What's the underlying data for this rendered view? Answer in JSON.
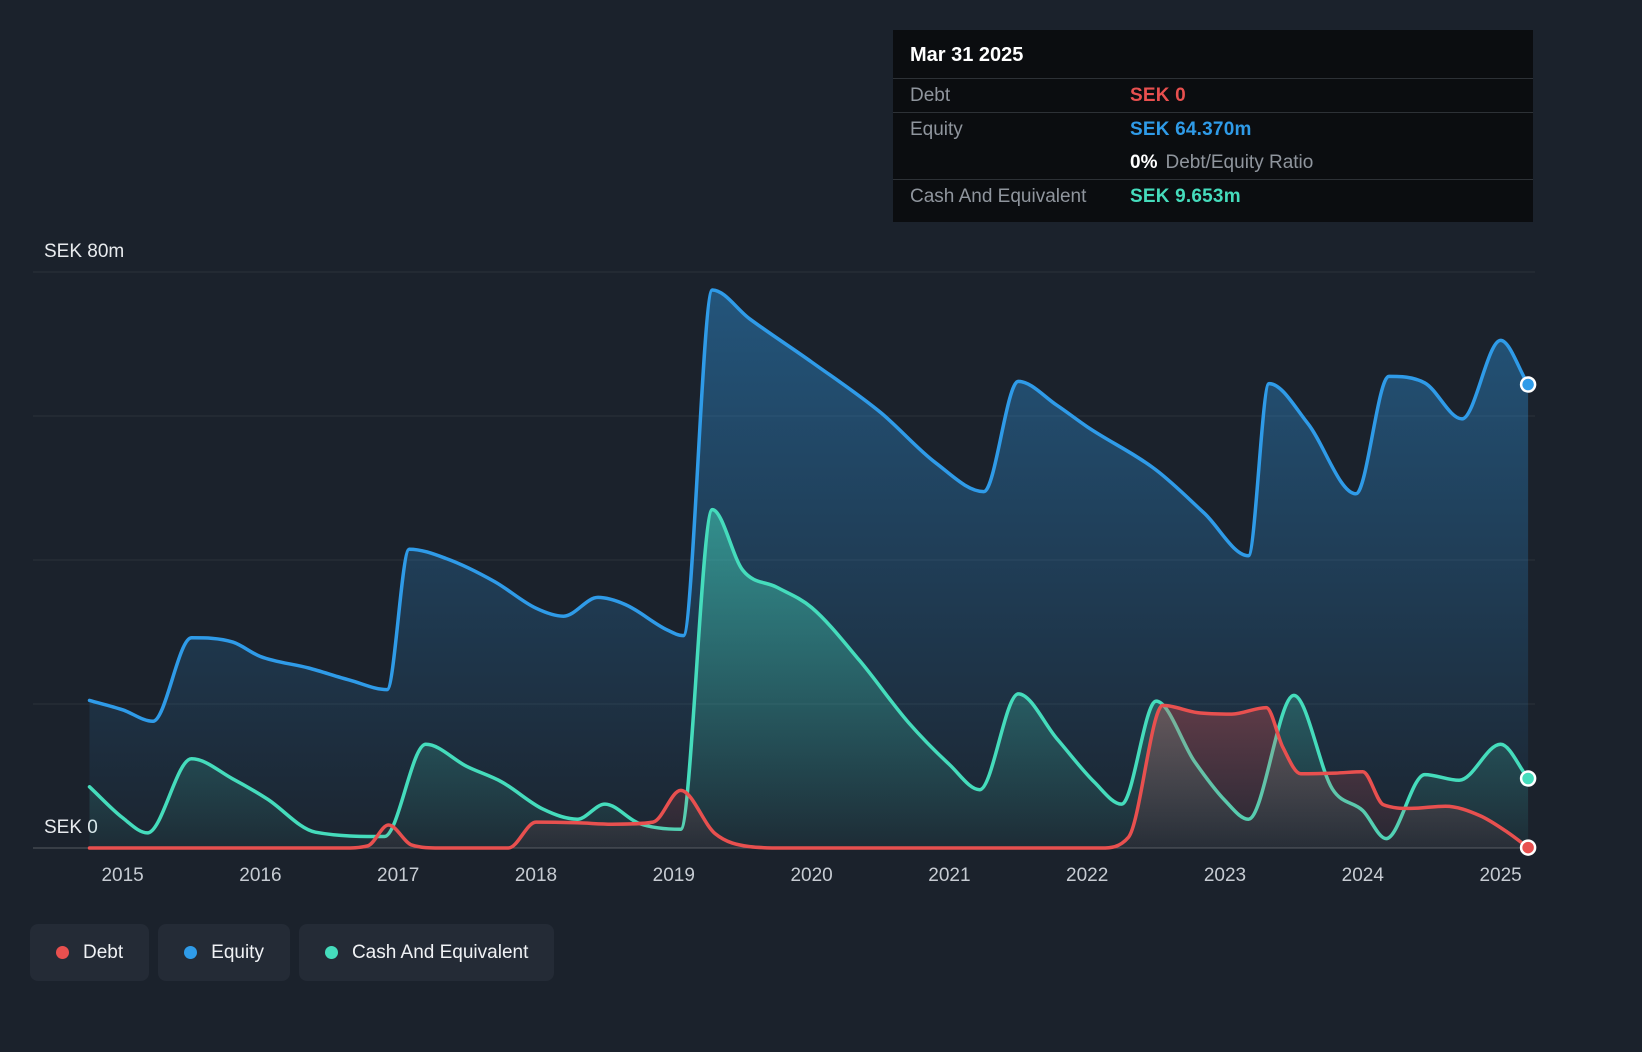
{
  "page": {
    "background": "#1b222c"
  },
  "tooltip": {
    "date": "Mar 31 2025",
    "debt": {
      "label": "Debt",
      "value": "SEK 0",
      "color": "#e8504f"
    },
    "equity": {
      "label": "Equity",
      "value": "SEK 64.370m",
      "color": "#2f9be8"
    },
    "ratio": {
      "value": "0%",
      "label": "Debt/Equity Ratio"
    },
    "cash": {
      "label": "Cash And Equivalent",
      "value": "SEK 9.653m",
      "color": "#45dcbc"
    }
  },
  "legend": {
    "items": [
      {
        "key": "debt",
        "label": "Debt",
        "color": "#e8504f"
      },
      {
        "key": "equity",
        "label": "Equity",
        "color": "#2f9be8"
      },
      {
        "key": "cash",
        "label": "Cash And Equivalent",
        "color": "#45dcbc"
      }
    ]
  },
  "chart_data": {
    "type": "area",
    "title": "",
    "xlim": [
      2014.35,
      2025.25
    ],
    "ylim": [
      0,
      80
    ],
    "gridlines": [
      0,
      20,
      40,
      60,
      80
    ],
    "x_ticks": [
      2015,
      2016,
      2017,
      2018,
      2019,
      2020,
      2021,
      2022,
      2023,
      2024,
      2025
    ],
    "y_ticks": [
      {
        "value": 80,
        "label": "SEK 80m"
      },
      {
        "value": 0,
        "label": "SEK 0"
      }
    ],
    "draw_order": [
      "equity",
      "cash",
      "debt"
    ],
    "series": [
      {
        "key": "debt",
        "name": "Debt",
        "color": "#e8504f",
        "fill_top": 0.32,
        "fill_bottom": 0.05,
        "points": [
          [
            2014.76,
            0
          ],
          [
            2015.5,
            0
          ],
          [
            2016.3,
            0
          ],
          [
            2016.6,
            0
          ],
          [
            2016.78,
            0.3
          ],
          [
            2016.93,
            3.2
          ],
          [
            2017.1,
            0.4
          ],
          [
            2017.3,
            0
          ],
          [
            2017.8,
            0
          ],
          [
            2018.0,
            3.6
          ],
          [
            2018.3,
            3.5
          ],
          [
            2018.55,
            3.3
          ],
          [
            2018.85,
            3.6
          ],
          [
            2019.05,
            8.0
          ],
          [
            2019.3,
            2.0
          ],
          [
            2019.55,
            0.2
          ],
          [
            2019.8,
            0
          ],
          [
            2020.5,
            0
          ],
          [
            2021.3,
            0
          ],
          [
            2022.1,
            0
          ],
          [
            2022.3,
            1.5
          ],
          [
            2022.55,
            19.8
          ],
          [
            2022.8,
            18.8
          ],
          [
            2023.05,
            18.6
          ],
          [
            2023.3,
            19.5
          ],
          [
            2023.42,
            14.0
          ],
          [
            2023.55,
            10.3
          ],
          [
            2023.8,
            10.4
          ],
          [
            2024.0,
            10.6
          ],
          [
            2024.15,
            6.0
          ],
          [
            2024.35,
            5.5
          ],
          [
            2024.6,
            5.8
          ],
          [
            2024.85,
            4.5
          ],
          [
            2025.05,
            2.2
          ],
          [
            2025.2,
            0.05
          ]
        ]
      },
      {
        "key": "equity",
        "name": "Equity",
        "color": "#2f9be8",
        "fill_top": 0.42,
        "fill_bottom": 0.02,
        "points": [
          [
            2014.76,
            20.5
          ],
          [
            2015.0,
            19.2
          ],
          [
            2015.22,
            17.6
          ],
          [
            2015.5,
            29.2
          ],
          [
            2015.8,
            28.6
          ],
          [
            2016.0,
            26.6
          ],
          [
            2016.35,
            25.0
          ],
          [
            2016.65,
            23.3
          ],
          [
            2016.92,
            22.0
          ],
          [
            2017.08,
            41.5
          ],
          [
            2017.35,
            40.2
          ],
          [
            2017.7,
            37.0
          ],
          [
            2018.0,
            33.3
          ],
          [
            2018.2,
            32.2
          ],
          [
            2018.45,
            34.8
          ],
          [
            2018.65,
            33.8
          ],
          [
            2018.95,
            30.3
          ],
          [
            2019.07,
            29.5
          ],
          [
            2019.28,
            77.5
          ],
          [
            2019.55,
            73.5
          ],
          [
            2020.0,
            67.5
          ],
          [
            2020.5,
            60.5
          ],
          [
            2020.9,
            53.5
          ],
          [
            2021.25,
            49.5
          ],
          [
            2021.5,
            64.8
          ],
          [
            2021.78,
            61.5
          ],
          [
            2022.0,
            58.5
          ],
          [
            2022.5,
            52.5
          ],
          [
            2022.85,
            46.5
          ],
          [
            2023.17,
            40.6
          ],
          [
            2023.32,
            64.5
          ],
          [
            2023.6,
            59.0
          ],
          [
            2023.95,
            49.2
          ],
          [
            2024.19,
            65.5
          ],
          [
            2024.45,
            64.6
          ],
          [
            2024.72,
            59.6
          ],
          [
            2025.0,
            70.5
          ],
          [
            2025.2,
            64.37
          ]
        ]
      },
      {
        "key": "cash",
        "name": "Cash And Equivalent",
        "color": "#45dcbc",
        "fill_top": 0.5,
        "fill_bottom": 0.04,
        "points": [
          [
            2014.76,
            8.5
          ],
          [
            2015.0,
            4.2
          ],
          [
            2015.18,
            2.1
          ],
          [
            2015.5,
            12.4
          ],
          [
            2015.8,
            9.6
          ],
          [
            2016.05,
            6.8
          ],
          [
            2016.4,
            2.2
          ],
          [
            2016.9,
            1.6
          ],
          [
            2017.2,
            14.4
          ],
          [
            2017.5,
            11.3
          ],
          [
            2017.75,
            9.2
          ],
          [
            2018.05,
            5.4
          ],
          [
            2018.3,
            4.0
          ],
          [
            2018.5,
            6.1
          ],
          [
            2018.75,
            3.4
          ],
          [
            2019.05,
            2.6
          ],
          [
            2019.28,
            47.0
          ],
          [
            2019.5,
            38.6
          ],
          [
            2019.75,
            36.2
          ],
          [
            2020.0,
            33.4
          ],
          [
            2020.35,
            26.0
          ],
          [
            2020.7,
            17.5
          ],
          [
            2021.0,
            11.6
          ],
          [
            2021.22,
            8.1
          ],
          [
            2021.5,
            21.4
          ],
          [
            2021.78,
            15.2
          ],
          [
            2022.05,
            9.2
          ],
          [
            2022.25,
            6.1
          ],
          [
            2022.5,
            20.4
          ],
          [
            2022.78,
            12.0
          ],
          [
            2023.0,
            6.6
          ],
          [
            2023.17,
            4.0
          ],
          [
            2023.5,
            21.2
          ],
          [
            2023.78,
            8.2
          ],
          [
            2024.0,
            5.2
          ],
          [
            2024.17,
            1.3
          ],
          [
            2024.45,
            10.2
          ],
          [
            2024.7,
            9.4
          ],
          [
            2025.0,
            14.4
          ],
          [
            2025.2,
            9.653
          ]
        ]
      }
    ]
  }
}
